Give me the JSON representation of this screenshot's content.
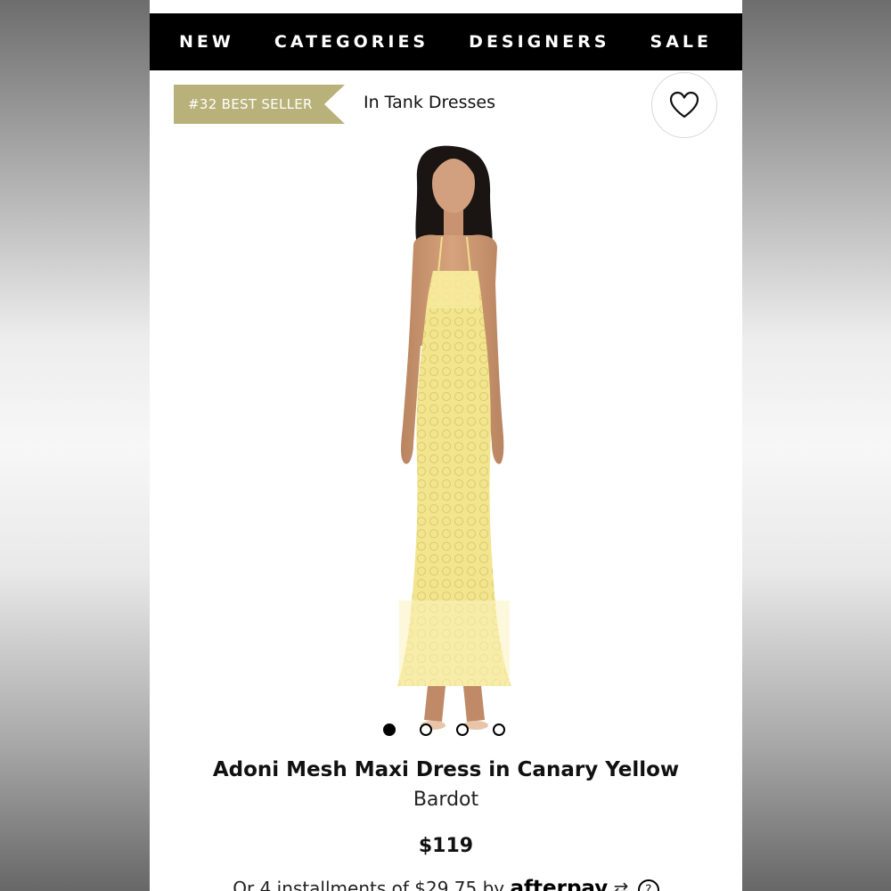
{
  "nav": {
    "items": [
      {
        "label": "NEW"
      },
      {
        "label": "CATEGORIES"
      },
      {
        "label": "DESIGNERS"
      },
      {
        "label": "SALE"
      }
    ]
  },
  "badge": {
    "rank_label": "#32 BEST SELLER",
    "category": "In Tank Dresses"
  },
  "wishlist": {
    "icon": "heart-icon"
  },
  "gallery": {
    "slide_count": 4,
    "active_index": 0
  },
  "product": {
    "title": "Adoni Mesh Maxi Dress in Canary Yellow",
    "brand": "Bardot",
    "price": "$119",
    "installments_text": "Or 4 installments of $29.75 by",
    "provider": "afterpay",
    "provider_icon": "afterpay-logo-icon",
    "info_icon": "info-icon"
  },
  "colors": {
    "badge": "#b9b17a",
    "nav_bg": "#000000",
    "dress": "#f3e58f"
  }
}
